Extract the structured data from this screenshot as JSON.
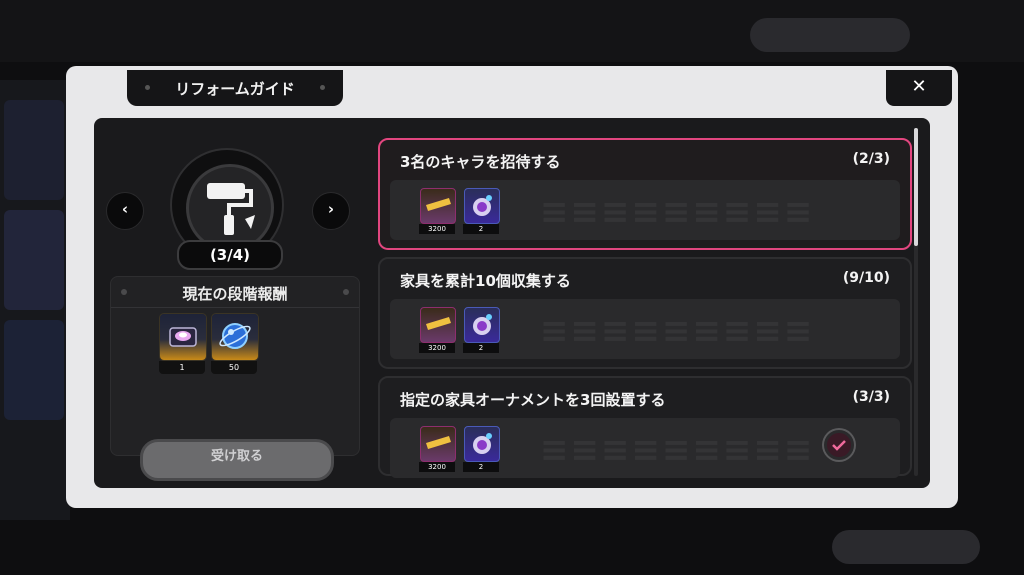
{
  "modal": {
    "title": "リフォームガイド",
    "close_label": "✕"
  },
  "stage": {
    "progress_label": "(3/4)",
    "prev_label": "‹",
    "next_label": "›"
  },
  "current_reward": {
    "title": "現在の段階報酬",
    "items": [
      {
        "icon": "gift-box-icon",
        "count": "1"
      },
      {
        "icon": "blue-orb-icon",
        "count": "50"
      }
    ],
    "receive_label": "受け取る"
  },
  "quests": [
    {
      "title": "3名のキャラを招待する",
      "progress": "(2/3)",
      "active": true,
      "completed": false,
      "rewards": [
        {
          "icon": "ticket-icon",
          "count": "3200"
        },
        {
          "icon": "planet-orb-icon",
          "count": "2"
        }
      ]
    },
    {
      "title": "家具を累計10個収集する",
      "progress": "(9/10)",
      "active": false,
      "completed": false,
      "rewards": [
        {
          "icon": "ticket-icon",
          "count": "3200"
        },
        {
          "icon": "planet-orb-icon",
          "count": "2"
        }
      ]
    },
    {
      "title": "指定の家具オーナメントを3回設置する",
      "progress": "(3/3)",
      "active": false,
      "completed": true,
      "rewards": [
        {
          "icon": "ticket-icon",
          "count": "3200"
        },
        {
          "icon": "planet-orb-icon",
          "count": "2"
        }
      ]
    }
  ],
  "colors": {
    "accent": "#e2467f",
    "modal_bg": "#e8e8ea",
    "panel_bg": "#1a1a1c"
  }
}
